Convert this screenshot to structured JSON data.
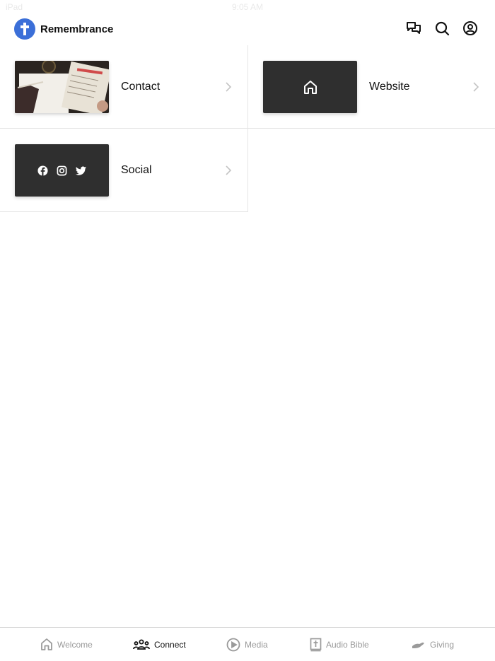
{
  "status_bar": {
    "carrier": "iPad",
    "time": "9:05 AM"
  },
  "header": {
    "title": "Remembrance",
    "logo_icon": "cross-icon",
    "actions": [
      "chat-icon",
      "search-icon",
      "account-icon"
    ],
    "logo_color": "#3b6fd8"
  },
  "items": [
    {
      "label": "Contact",
      "thumb": "bible-photo"
    },
    {
      "label": "Website",
      "thumb": "home-icon"
    },
    {
      "label": "Social",
      "thumb": "social-icons"
    }
  ],
  "tabs": [
    {
      "label": "Welcome",
      "icon": "home-icon",
      "active": false
    },
    {
      "label": "Connect",
      "icon": "people-icon",
      "active": true
    },
    {
      "label": "Media",
      "icon": "play-icon",
      "active": false
    },
    {
      "label": "Audio Bible",
      "icon": "bible-icon",
      "active": false
    },
    {
      "label": "Giving",
      "icon": "giving-hand-icon",
      "active": false
    }
  ]
}
